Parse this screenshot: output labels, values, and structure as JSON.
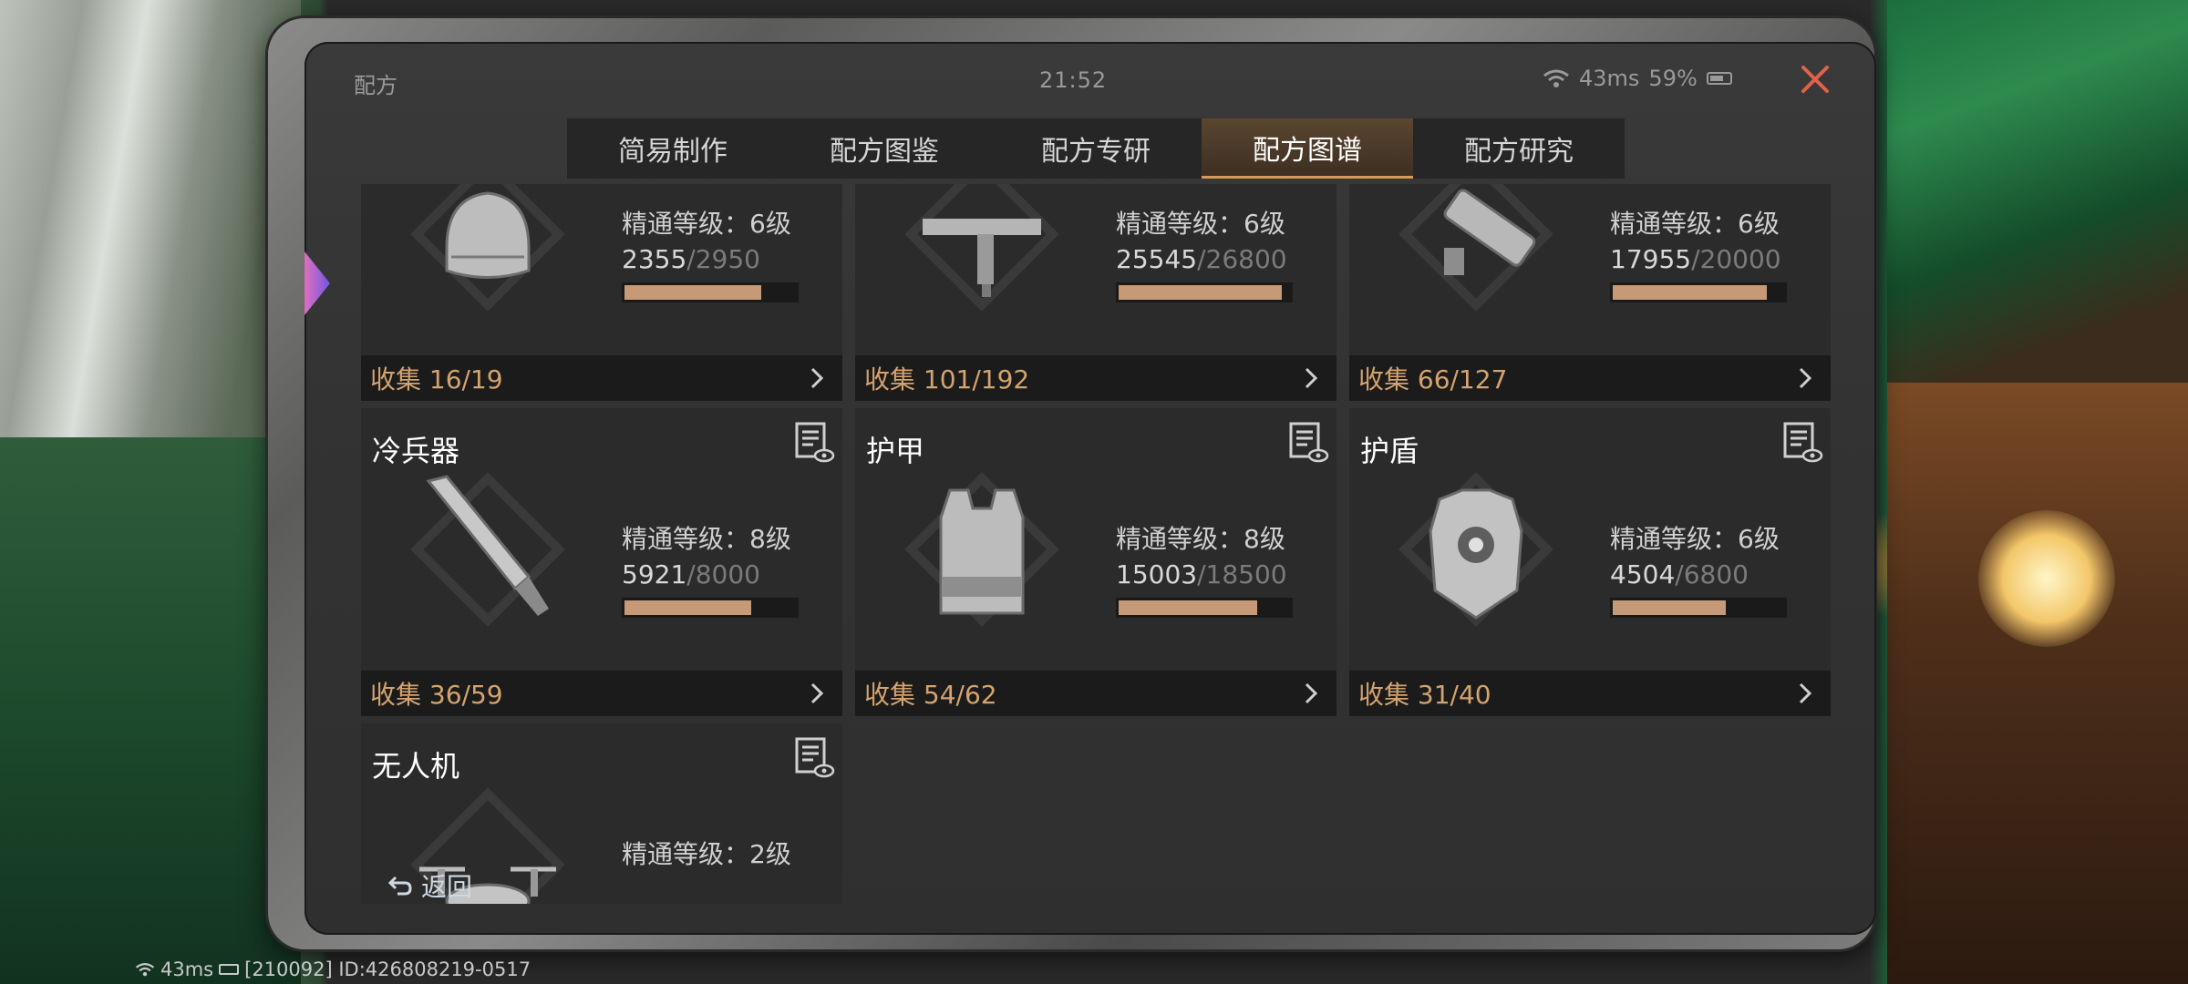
{
  "status_bar": {
    "title": "配方",
    "time": "21:52",
    "ping": "43ms",
    "battery": "59%"
  },
  "tabs": [
    {
      "label": "简易制作",
      "active": false
    },
    {
      "label": "配方图鉴",
      "active": false
    },
    {
      "label": "配方专研",
      "active": false
    },
    {
      "label": "配方图谱",
      "active": true
    },
    {
      "label": "配方研究",
      "active": false
    }
  ],
  "cards": [
    {
      "name": "",
      "level": "精通等级：6级",
      "current": "2355",
      "max": "/2950",
      "progress": 0.8,
      "collect": "收集 16/19",
      "icon": "helmet-icon"
    },
    {
      "name": "",
      "level": "精通等级：6级",
      "current": "25545",
      "max": "/26800",
      "progress": 0.95,
      "collect": "收集 101/192",
      "icon": "smg-icon"
    },
    {
      "name": "",
      "level": "精通等级：6级",
      "current": "17955",
      "max": "/20000",
      "progress": 0.9,
      "collect": "收集 66/127",
      "icon": "launcher-icon"
    },
    {
      "name": "冷兵器",
      "level": "精通等级：8级",
      "current": "5921",
      "max": "/8000",
      "progress": 0.74,
      "collect": "收集 36/59",
      "icon": "machete-icon"
    },
    {
      "name": "护甲",
      "level": "精通等级：8级",
      "current": "15003",
      "max": "/18500",
      "progress": 0.81,
      "collect": "收集 54/62",
      "icon": "armor-vest-icon"
    },
    {
      "name": "护盾",
      "level": "精通等级：6级",
      "current": "4504",
      "max": "/6800",
      "progress": 0.66,
      "collect": "收集 31/40",
      "icon": "shield-armor-icon"
    },
    {
      "name": "无人机",
      "level": "精通等级：2级",
      "current": "",
      "max": "",
      "progress": null,
      "collect": "",
      "icon": "drone-icon"
    }
  ],
  "back_button": {
    "label": "返回"
  },
  "footer": {
    "ping": "43ms",
    "id_text": "[210092] ID:426808219-0517"
  },
  "colors": {
    "accent": "#d4a36e",
    "progress_fill": "#c69a77",
    "close": "#e0624a"
  }
}
